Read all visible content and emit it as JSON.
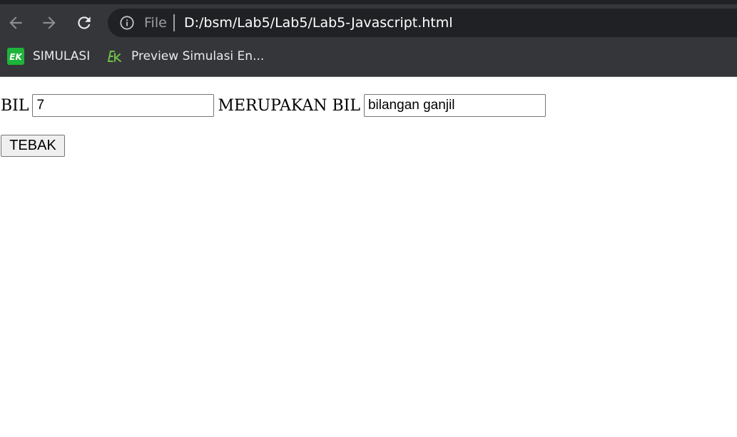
{
  "browser": {
    "address_bar": {
      "scheme_label": "File",
      "url": "D:/bsm/Lab5/Lab5/Lab5-Javascript.html"
    },
    "bookmarks": [
      {
        "label": "SIMULASI",
        "icon": "ek-green-icon"
      },
      {
        "label": "Preview Simulasi En...",
        "icon": "ek-outline-icon"
      }
    ],
    "colors": {
      "toolbar_bg": "#35363a",
      "omnibox_bg": "#202124",
      "ek_green": "#1db43a"
    }
  },
  "page": {
    "form": {
      "label_bil": "BIL",
      "input_bil_value": "7",
      "label_merupakan": "MERUPAKAN BIL",
      "output_value": "bilangan ganjil",
      "submit_label": "TEBAK"
    }
  }
}
